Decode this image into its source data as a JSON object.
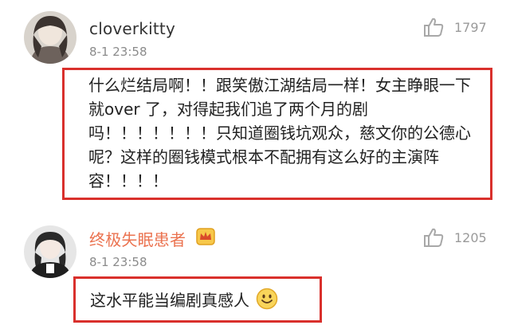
{
  "comments": [
    {
      "username": "cloverkitty",
      "time": "8-1 23:58",
      "likes": "1797",
      "text": "什么烂结局啊！！跟笑傲江湖结局一样！女主睁眼一下就over 了，对得起我们追了两个月的剧吗！！！！！！！只知道圈钱坑观众，慈文你的公德心呢？这样的圈钱模式根本不配拥有这么好的主演阵容！！！！",
      "username_color": "#333333"
    },
    {
      "username": "终极失眠患者",
      "time": "8-1 23:58",
      "likes": "1205",
      "text": "这水平能当编剧真感人",
      "username_color": "#eb7350",
      "badge_icon": "crown-icon"
    }
  ],
  "colors": {
    "highlight_box": "#d9302c",
    "meta_text": "#8b8b8b"
  }
}
